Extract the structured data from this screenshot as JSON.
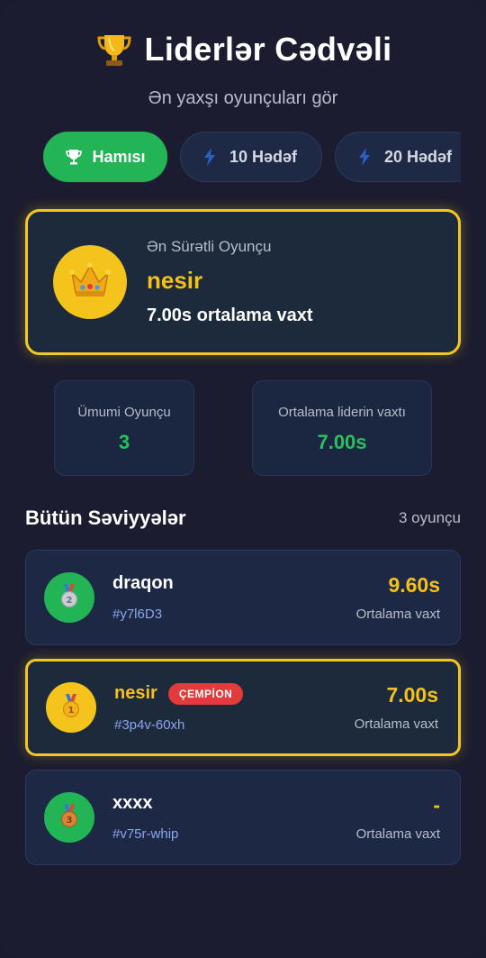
{
  "header": {
    "title": "Liderlər Cədvəli",
    "subtitle": "Ən yaxşı oyunçuları gör"
  },
  "tabs": [
    {
      "label": "Hamısı",
      "icon": "trophy-icon",
      "active": true
    },
    {
      "label": "10 Hədəf",
      "icon": "lightning-icon",
      "active": false
    },
    {
      "label": "20 Hədəf",
      "icon": "lightning-icon",
      "active": false
    }
  ],
  "champion": {
    "label": "Ən Sürətli Oyunçu",
    "name": "nesir",
    "time": "7.00s ortalama vaxt",
    "icon": "crown-icon"
  },
  "stats": [
    {
      "label": "Ümumi Oyunçu",
      "value": "3"
    },
    {
      "label": "Ortalama liderin vaxtı",
      "value": "7.00s"
    }
  ],
  "section": {
    "title": "Bütün Səviyyələr",
    "count": "3 oyunçu"
  },
  "players": [
    {
      "name": "draqon",
      "id": "#y7l6D3",
      "time": "9.60s",
      "sub": "Ortalama vaxt",
      "medal": "silver-medal-icon",
      "champion": false,
      "badge": ""
    },
    {
      "name": "nesir",
      "id": "#3p4v-60xh",
      "time": "7.00s",
      "sub": "Ortalama vaxt",
      "medal": "gold-medal-icon",
      "champion": true,
      "badge": "ÇEMPİON"
    },
    {
      "name": "xxxx",
      "id": "#v75r-whip",
      "time": "-",
      "sub": "Ortalama vaxt",
      "medal": "bronze-medal-icon",
      "champion": false,
      "badge": ""
    }
  ],
  "colors": {
    "background": "#1b1c2f",
    "accent_green": "#22b455",
    "gold": "#f5c116",
    "badge_red": "#e23b3b",
    "id_blue": "#8aa6ee"
  }
}
